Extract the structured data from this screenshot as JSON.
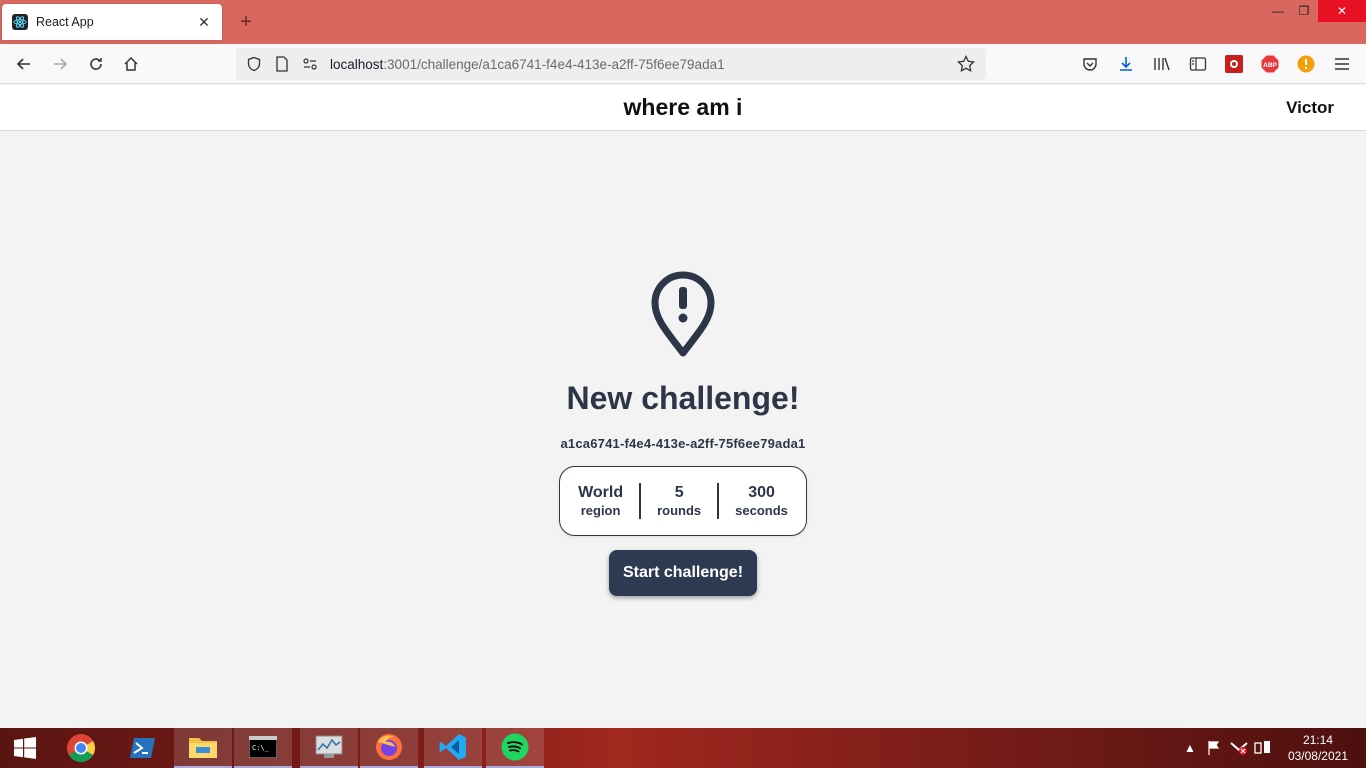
{
  "browser": {
    "tab_title": "React App",
    "url_host": "localhost",
    "url_rest": ":3001/challenge/a1ca6741-f4e4-413e-a2ff-75f6ee79ada1"
  },
  "header": {
    "app_title": "where am i",
    "user_name": "Victor"
  },
  "challenge": {
    "headline": "New challenge!",
    "id": "a1ca6741-f4e4-413e-a2ff-75f6ee79ada1",
    "stats": [
      {
        "value": "World",
        "label": "region"
      },
      {
        "value": "5",
        "label": "rounds"
      },
      {
        "value": "300",
        "label": "seconds"
      }
    ],
    "start_label": "Start challenge!"
  },
  "taskbar": {
    "time": "21:14",
    "date": "03/08/2021"
  },
  "colors": {
    "accent": "#2e3a52",
    "titlebar": "#d8685f",
    "page_bg": "#f3f3f3"
  }
}
